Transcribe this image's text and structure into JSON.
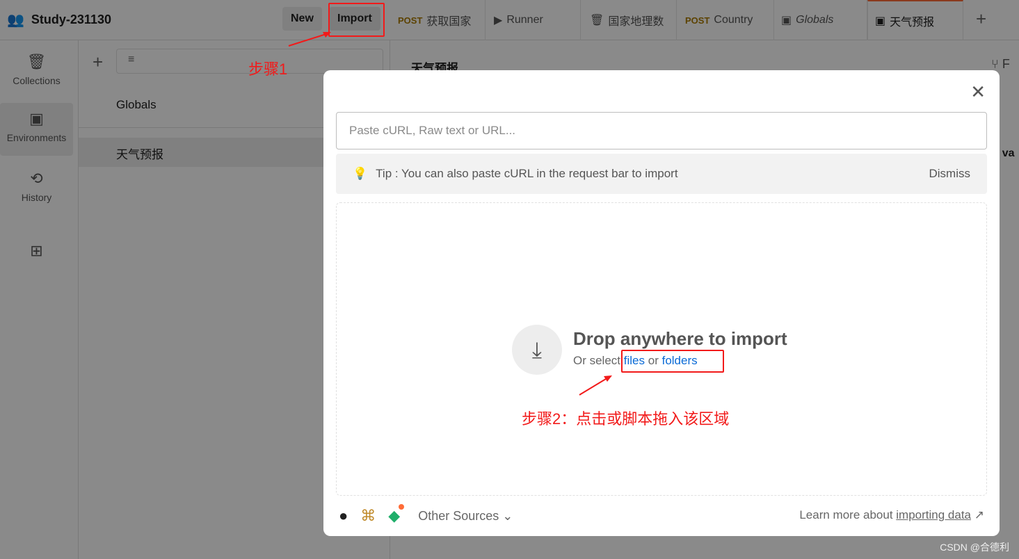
{
  "workspace": {
    "name": "Study-231130",
    "icon": "team-icon"
  },
  "header": {
    "new_label": "New",
    "import_label": "Import"
  },
  "tabs": [
    {
      "method": "POST",
      "label": "获取国家"
    },
    {
      "label": "Runner",
      "icon": "runner-icon"
    },
    {
      "label": "国家地理数",
      "icon": "collection-icon"
    },
    {
      "method": "POST",
      "label": "Country"
    },
    {
      "label": "Globals",
      "icon": "environment-icon"
    },
    {
      "label": "天气预报",
      "icon": "environment-icon",
      "active": true
    }
  ],
  "sidebar": {
    "items": [
      {
        "label": "Collections",
        "icon": "collection-icon"
      },
      {
        "label": "Environments",
        "icon": "environment-icon",
        "active": true
      },
      {
        "label": "History",
        "icon": "history-icon"
      },
      {
        "label": "",
        "icon": "apps-add-icon"
      }
    ]
  },
  "env_list": {
    "items": [
      "Globals",
      "天气预报"
    ]
  },
  "main": {
    "title": "天气预报",
    "fork_label": "F",
    "column_partial": "t va"
  },
  "modal": {
    "input_placeholder": "Paste cURL, Raw text or URL...",
    "tip": "Tip : You can also paste cURL in the request bar to import",
    "dismiss": "Dismiss",
    "drop_title": "Drop anywhere to import",
    "drop_sub_prefix": "Or select",
    "files": "files",
    "or": "or",
    "folders": "folders",
    "other_sources": "Other Sources",
    "learn_prefix": "Learn more about",
    "learn_link": "importing data"
  },
  "annotations": {
    "step1": "步骤1",
    "step2": "步骤2：点击或脚本拖入该区域"
  },
  "watermark": "CSDN @合德利",
  "colors": {
    "accent": "#ff6c37",
    "annotation": "#f21a1a",
    "link": "#0a6ad6"
  }
}
